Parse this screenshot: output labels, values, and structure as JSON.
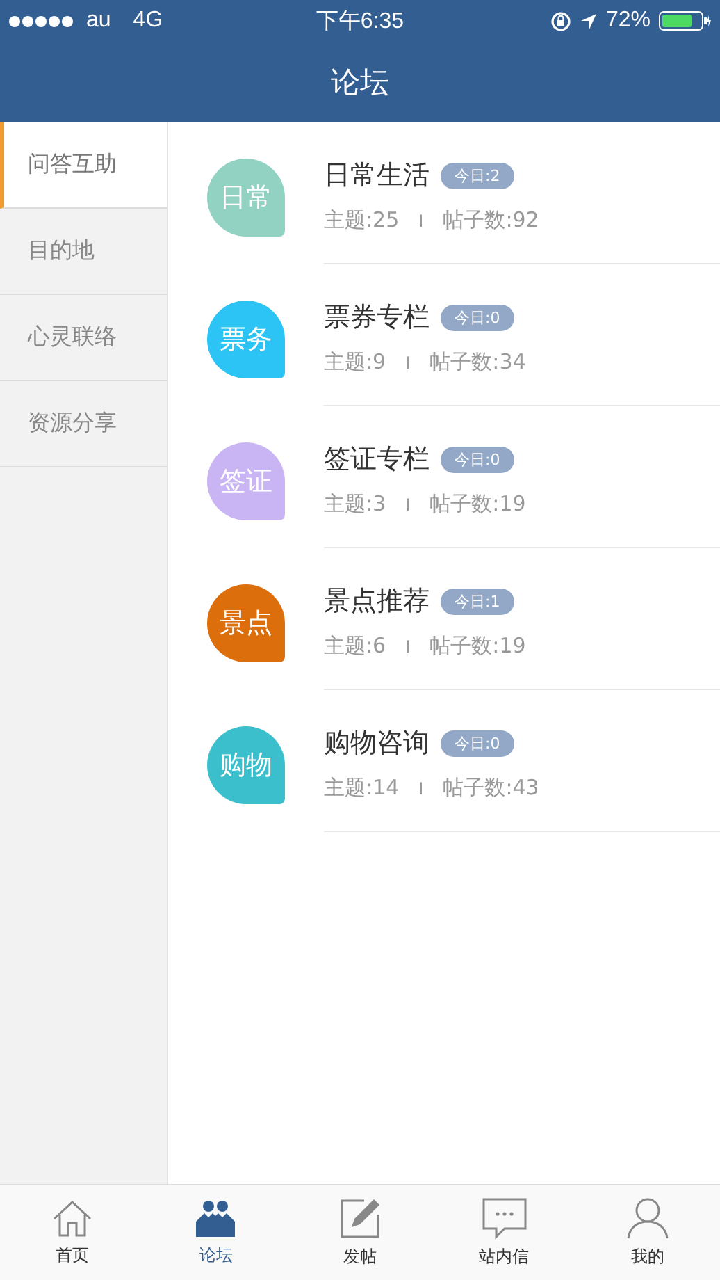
{
  "status_bar": {
    "carrier": "au",
    "network": "4G",
    "time": "下午6:35",
    "battery": "72%"
  },
  "nav": {
    "title": "论坛"
  },
  "sidebar": {
    "items": [
      {
        "label": "问答互助",
        "selected": true
      },
      {
        "label": "目的地",
        "selected": false
      },
      {
        "label": "心灵联络",
        "selected": false
      },
      {
        "label": "资源分享",
        "selected": false
      }
    ]
  },
  "forums": [
    {
      "icon_text": "日常",
      "color": "#92d2c2",
      "name": "日常生活",
      "today": "今日:2",
      "topics": "主题:25",
      "separator": "I",
      "posts": "帖子数:92"
    },
    {
      "icon_text": "票务",
      "color": "#2bc4f4",
      "name": "票券专栏",
      "today": "今日:0",
      "topics": "主题:9",
      "separator": "I",
      "posts": "帖子数:34"
    },
    {
      "icon_text": "签证",
      "color": "#c9b5f3",
      "name": "签证专栏",
      "today": "今日:0",
      "topics": "主题:3",
      "separator": "I",
      "posts": "帖子数:19"
    },
    {
      "icon_text": "景点",
      "color": "#dc6e0c",
      "name": "景点推荐",
      "today": "今日:1",
      "topics": "主题:6",
      "separator": "I",
      "posts": "帖子数:19"
    },
    {
      "icon_text": "购物",
      "color": "#3bbfcc",
      "name": "购物咨询",
      "today": "今日:0",
      "topics": "主题:14",
      "separator": "I",
      "posts": "帖子数:43"
    }
  ],
  "tab_bar": [
    {
      "kind": "home",
      "label": "首页",
      "selected": false
    },
    {
      "kind": "forum",
      "label": "论坛",
      "selected": true
    },
    {
      "kind": "post",
      "label": "发帖",
      "selected": false
    },
    {
      "kind": "message",
      "label": "站内信",
      "selected": false
    },
    {
      "kind": "profile",
      "label": "我的",
      "selected": false
    }
  ]
}
